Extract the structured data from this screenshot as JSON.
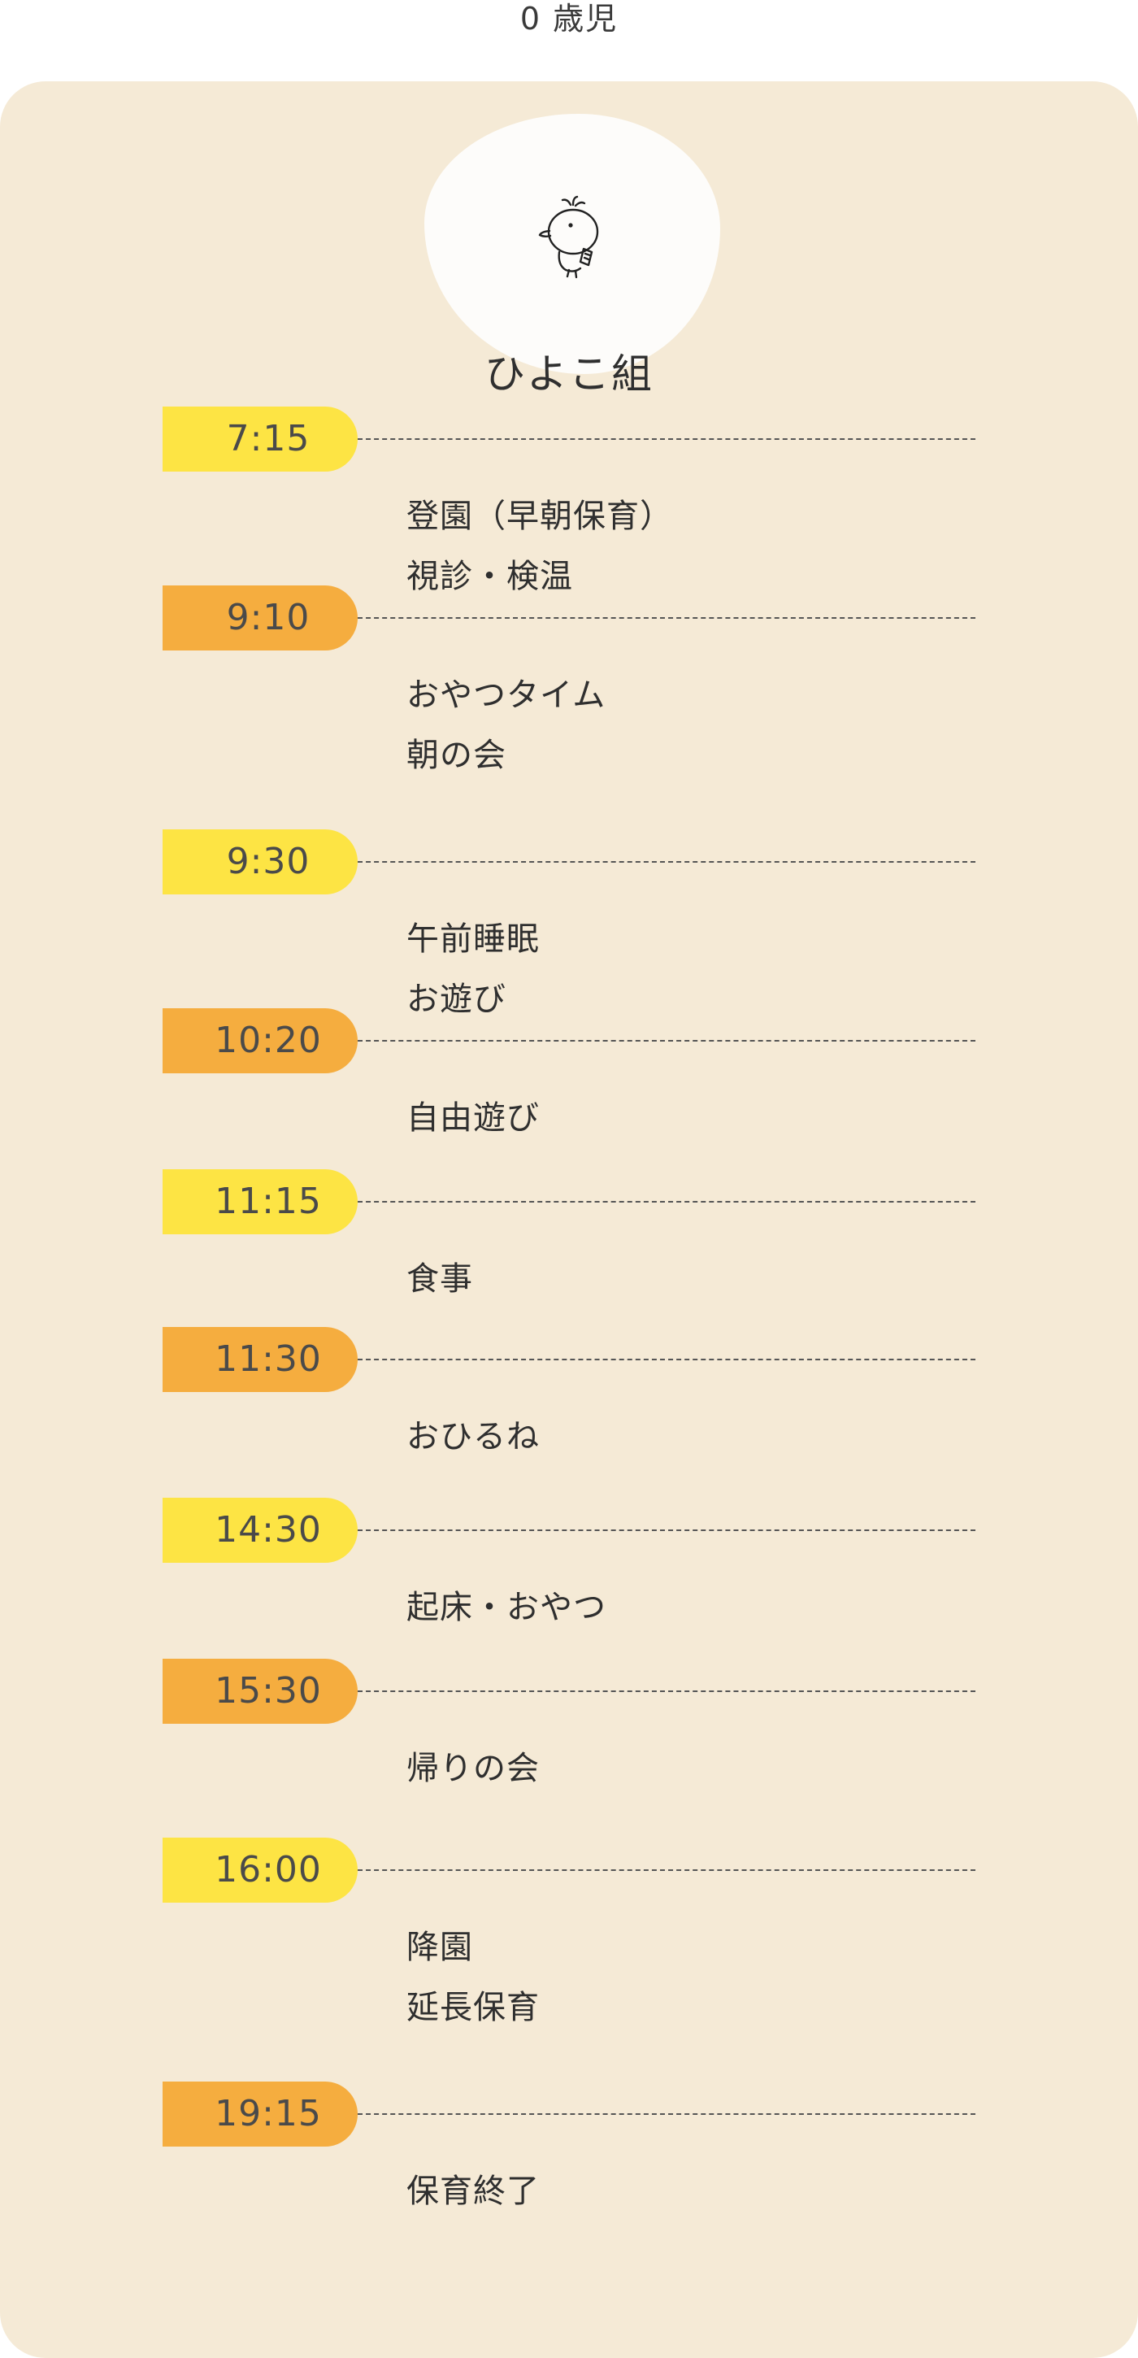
{
  "header": {
    "age_label": "0 歳児",
    "class_name": "ひよこ組",
    "mascot_icon": "chick-icon"
  },
  "colors": {
    "card_background": "#f5ead6",
    "pill_yellow": "#fde444",
    "pill_orange": "#f5ad3f"
  },
  "schedule": [
    {
      "time": "7:15",
      "color": "yellow",
      "activities": [
        "登園（早朝保育）",
        "視診・検温"
      ]
    },
    {
      "time": "9:10",
      "color": "orange",
      "activities": [
        "おやつタイム",
        "朝の会"
      ]
    },
    {
      "time": "9:30",
      "color": "yellow",
      "activities": [
        "午前睡眠",
        "お遊び"
      ]
    },
    {
      "time": "10:20",
      "color": "orange",
      "activities": [
        "自由遊び"
      ]
    },
    {
      "time": "11:15",
      "color": "yellow",
      "activities": [
        "食事"
      ]
    },
    {
      "time": "11:30",
      "color": "orange",
      "activities": [
        "おひるね"
      ]
    },
    {
      "time": "14:30",
      "color": "yellow",
      "activities": [
        "起床・おやつ"
      ]
    },
    {
      "time": "15:30",
      "color": "orange",
      "activities": [
        "帰りの会"
      ]
    },
    {
      "time": "16:00",
      "color": "yellow",
      "activities": [
        "降園",
        "延長保育"
      ]
    },
    {
      "time": "19:15",
      "color": "orange",
      "activities": [
        "保育終了"
      ]
    }
  ]
}
